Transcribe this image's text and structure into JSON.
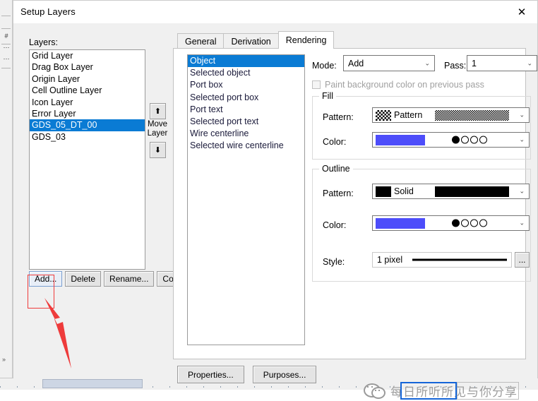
{
  "window": {
    "title": "Setup Layers",
    "close_icon": "close-icon"
  },
  "layers_panel": {
    "label": "Layers:",
    "items": [
      {
        "name": "Grid Layer",
        "selected": false
      },
      {
        "name": "Drag Box Layer",
        "selected": false
      },
      {
        "name": "Origin Layer",
        "selected": false
      },
      {
        "name": "Cell Outline Layer",
        "selected": false
      },
      {
        "name": "Icon Layer",
        "selected": false
      },
      {
        "name": "Error Layer",
        "selected": false
      },
      {
        "name": "GDS_05_DT_00",
        "selected": true
      },
      {
        "name": "GDS_03",
        "selected": false
      }
    ],
    "move": {
      "up_icon": "arrow-up-icon",
      "down_icon": "arrow-down-icon",
      "label_line1": "Move",
      "label_line2": "Layer"
    },
    "buttons": [
      {
        "label": "Add...",
        "focused": true
      },
      {
        "label": "Delete",
        "focused": false
      },
      {
        "label": "Rename...",
        "focused": false
      },
      {
        "label": "Copy...",
        "focused": false
      }
    ]
  },
  "tabs": [
    {
      "label": "General",
      "active": false
    },
    {
      "label": "Derivation",
      "active": false
    },
    {
      "label": "Rendering",
      "active": true
    }
  ],
  "rendering": {
    "targets": [
      {
        "name": "Object",
        "selected": true
      },
      {
        "name": "Selected object",
        "selected": false
      },
      {
        "name": "Port box",
        "selected": false
      },
      {
        "name": "Selected port box",
        "selected": false
      },
      {
        "name": "Port text",
        "selected": false
      },
      {
        "name": "Selected port text",
        "selected": false
      },
      {
        "name": "Wire centerline",
        "selected": false
      },
      {
        "name": "Selected wire centerline",
        "selected": false
      }
    ],
    "mode": {
      "label": "Mode:",
      "value": "Add",
      "chevron_icon": "chevron-down-icon"
    },
    "pass": {
      "label": "Pass:",
      "value": "1",
      "chevron_icon": "chevron-down-icon"
    },
    "paint_background": {
      "label": "Paint background color on previous pass",
      "checked": false,
      "enabled": false
    },
    "fill": {
      "legend": "Fill",
      "pattern": {
        "label": "Pattern:",
        "value": "Pattern",
        "swatch": "checker",
        "chevron_icon": "chevron-down-icon"
      },
      "color": {
        "label": "Color:",
        "value": "",
        "swatch_hex": "#4d4dfa",
        "dots": [
          true,
          false,
          false,
          false
        ],
        "chevron_icon": "chevron-down-icon"
      }
    },
    "outline": {
      "legend": "Outline",
      "pattern": {
        "label": "Pattern:",
        "value": "Solid",
        "swatch": "solid",
        "chevron_icon": "chevron-down-icon"
      },
      "color": {
        "label": "Color:",
        "value": "",
        "swatch_hex": "#4d4dfa",
        "dots": [
          true,
          false,
          false,
          false
        ],
        "chevron_icon": "chevron-down-icon"
      },
      "style": {
        "label": "Style:",
        "value": "1 pixel",
        "ellipsis_label": "..."
      }
    }
  },
  "footer": {
    "buttons": [
      {
        "label": "Properties..."
      },
      {
        "label": "Purposes..."
      }
    ]
  },
  "annotation": {
    "highlight_target": "Add...",
    "arrow_color": "#ee3b3b",
    "box_color": "#ef3b3b"
  },
  "watermark": {
    "text": "每日所听所见与你分享",
    "logo_icon": "wechat-icon",
    "accent_hex": "#1565d8"
  }
}
